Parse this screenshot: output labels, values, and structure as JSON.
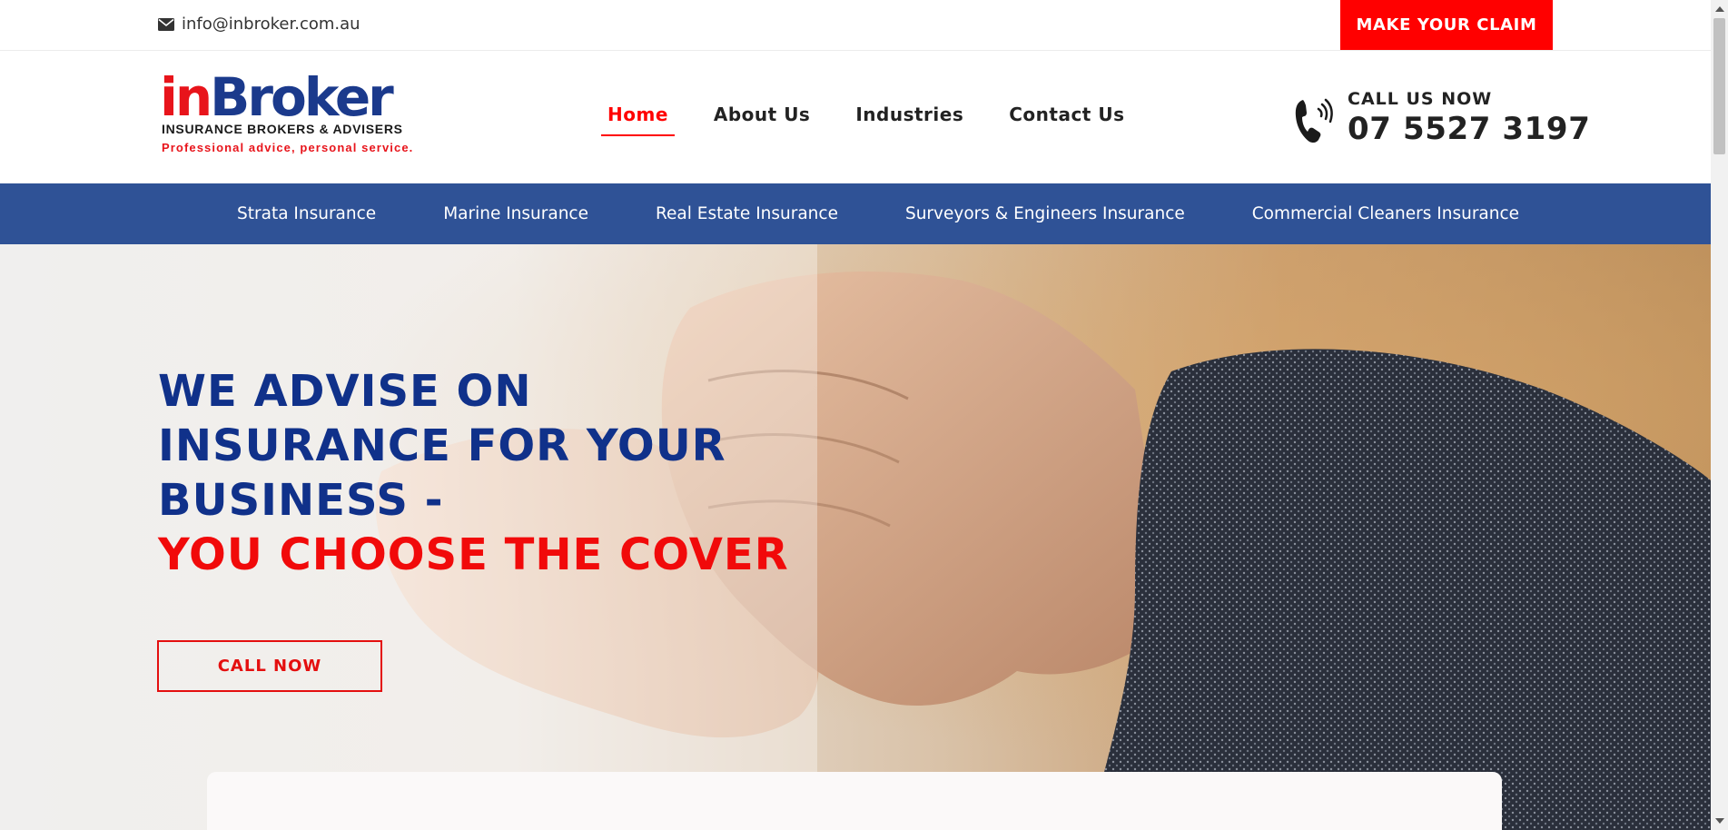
{
  "topbar": {
    "email": "info@inbroker.com.au",
    "email_icon": "envelope-icon",
    "claim_label": "MAKE YOUR CLAIM"
  },
  "logo": {
    "part1": "in",
    "part2": "Broker",
    "subtitle": "INSURANCE BROKERS & ADVISERS",
    "tagline": "Professional advice, personal service."
  },
  "nav": {
    "items": [
      {
        "label": "Home",
        "active": true
      },
      {
        "label": "About Us",
        "active": false
      },
      {
        "label": "Industries",
        "active": false
      },
      {
        "label": "Contact Us",
        "active": false
      }
    ]
  },
  "call": {
    "icon": "phone-icon",
    "label": "CALL US NOW",
    "number": "07 5527 3197"
  },
  "categories": {
    "items": [
      {
        "label": "Strata Insurance"
      },
      {
        "label": "Marine Insurance"
      },
      {
        "label": "Real Estate Insurance"
      },
      {
        "label": "Surveyors & Engineers Insurance"
      },
      {
        "label": "Commercial Cleaners Insurance"
      }
    ]
  },
  "hero": {
    "line1": "WE ADVISE ON",
    "line2": "INSURANCE FOR YOUR",
    "line3": "BUSINESS -",
    "line4": "YOU CHOOSE THE COVER",
    "button_label": "CALL NOW"
  },
  "colors": {
    "accent_red": "#ff0000",
    "brand_blue": "#2f5296",
    "hero_blue": "#10318a"
  }
}
